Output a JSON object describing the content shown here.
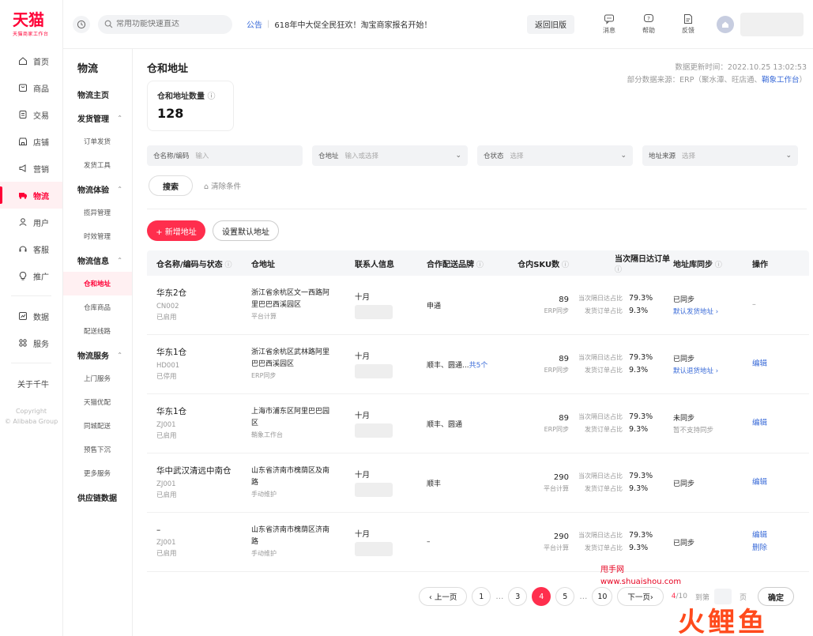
{
  "brand": {
    "name": "天猫",
    "subtitle": "天猫商家工作台"
  },
  "left_nav": {
    "items": [
      {
        "label": "首页",
        "icon": "home-icon"
      },
      {
        "label": "商品",
        "icon": "goods-icon"
      },
      {
        "label": "交易",
        "icon": "trade-icon"
      },
      {
        "label": "店铺",
        "icon": "store-icon"
      },
      {
        "label": "营销",
        "icon": "marketing-icon"
      },
      {
        "label": "物流",
        "icon": "logistics-icon",
        "active": true
      },
      {
        "label": "用户",
        "icon": "user-icon"
      },
      {
        "label": "客服",
        "icon": "service-icon"
      },
      {
        "label": "推广",
        "icon": "promotion-icon"
      }
    ],
    "items2": [
      {
        "label": "数据",
        "icon": "data-icon"
      },
      {
        "label": "服务",
        "icon": "apps-icon"
      }
    ],
    "about": "关于千牛",
    "copyright_1": "Copyright",
    "copyright_2": "© Alibaba Group"
  },
  "topbar": {
    "search_placeholder": "常用功能快速直达",
    "notice_tag": "公告",
    "notice_text": "618年中大促全民狂欢！淘宝商家报名开始！",
    "back_label": "返回旧版",
    "actions": [
      {
        "label": "消息",
        "icon": "message-icon"
      },
      {
        "label": "帮助",
        "icon": "help-icon"
      },
      {
        "label": "反馈",
        "icon": "feedback-icon"
      }
    ]
  },
  "sub_nav": {
    "title": "物流",
    "home": "物流主页",
    "groups": [
      {
        "label": "发货管理",
        "items": [
          "订单发货",
          "发货工具"
        ]
      },
      {
        "label": "物流体验",
        "items": [
          "揽异管理",
          "时效管理"
        ]
      },
      {
        "label": "物流信息",
        "items": [
          "仓和地址",
          "仓库商品",
          "配送线路"
        ]
      },
      {
        "label": "物流服务",
        "items": [
          "上门服务",
          "天猫优配",
          "同城配送",
          "预售下沉",
          "更多服务"
        ]
      }
    ],
    "footer": "供应链数据"
  },
  "main": {
    "title": "仓和地址",
    "update_time": "数据更新时间：2022.10.25 13:02:53",
    "source_prefix": "部分数据来源：ERP（聚水潭、旺店通、",
    "source_link": "鞘象工作台",
    "source_suffix": "）",
    "stat_label": "仓和地址数量",
    "stat_value": "128",
    "filters": [
      {
        "label": "仓名称/编码",
        "placeholder": "输入",
        "has_chevron": false
      },
      {
        "label": "仓地址",
        "placeholder": "输入或选择",
        "has_chevron": true
      },
      {
        "label": "仓状态",
        "placeholder": "选择",
        "has_chevron": true
      },
      {
        "label": "地址来源",
        "placeholder": "选择",
        "has_chevron": true
      }
    ],
    "search_label": "搜索",
    "clear_label": "清除条件",
    "add_label": "+ 新增地址",
    "default_label": "设置默认地址"
  },
  "table": {
    "headers": [
      "仓名称/编码与状态",
      "仓地址",
      "联系人信息",
      "合作配送品牌",
      "仓内SKU数",
      "当次隔日达订单",
      "地址库同步",
      "操作"
    ],
    "ratio_labels": [
      "当次隔日达占比",
      "发货订单占比"
    ],
    "rows": [
      {
        "name": "华东2仓",
        "code": "CN002",
        "state": "已启用",
        "addr1": "浙江省余杭区文一西路阿",
        "addr2": "里巴巴西溪园区",
        "addr_src": "平台计算",
        "contact": "十月",
        "brand": "申通",
        "brand_more": "",
        "sku": "89",
        "sku_src": "ERP同步",
        "r1": "79.3%",
        "r2": "9.3%",
        "sync": "已同步",
        "sync_link": "默认发货地址 ›",
        "sync_note": "",
        "ops": [
          "–"
        ]
      },
      {
        "name": "华东1仓",
        "code": "HD001",
        "state": "已停用",
        "addr1": "浙江省余杭区武林路阿里",
        "addr2": "巴巴西溪园区",
        "addr_src": "ERP同步",
        "contact": "十月",
        "brand": "顺丰、圆通...",
        "brand_more": "共5个",
        "sku": "89",
        "sku_src": "ERP同步",
        "r1": "79.3%",
        "r2": "9.3%",
        "sync": "已同步",
        "sync_link": "默认退货地址 ›",
        "sync_note": "",
        "ops": [
          "编辑"
        ]
      },
      {
        "name": "华东1仓",
        "code": "ZJ001",
        "state": "已启用",
        "addr1": "上海市浦东区阿里巴巴园",
        "addr2": "区",
        "addr_src": "鞘象工作台",
        "contact": "十月",
        "brand": "顺丰、圆通",
        "brand_more": "",
        "sku": "89",
        "sku_src": "ERP同步",
        "r1": "79.3%",
        "r2": "9.3%",
        "sync": "未同步",
        "sync_link": "",
        "sync_note": "暂不支持同步",
        "ops": [
          "编辑"
        ]
      },
      {
        "name": "华中武汉清远中南仓",
        "code": "ZJ001",
        "state": "已启用",
        "addr1": "山东省济南市槐荫区及南",
        "addr2": "路",
        "addr_src": "手动维护",
        "contact": "十月",
        "brand": "顺丰",
        "brand_more": "",
        "sku": "290",
        "sku_src": "平台计算",
        "r1": "79.3%",
        "r2": "9.3%",
        "sync": "已同步",
        "sync_link": "",
        "sync_note": "",
        "ops": [
          "编辑"
        ]
      },
      {
        "name": "–",
        "code": "ZJ001",
        "state": "已启用",
        "addr1": "山东省济南市槐荫区济南",
        "addr2": "路",
        "addr_src": "手动维护",
        "contact": "十月",
        "brand": "–",
        "brand_more": "",
        "sku": "290",
        "sku_src": "平台计算",
        "r1": "79.3%",
        "r2": "9.3%",
        "sync": "已同步",
        "sync_link": "",
        "sync_note": "",
        "ops": [
          "编辑",
          "删除"
        ]
      }
    ]
  },
  "pager": {
    "prev": "‹ 上一页",
    "pages": [
      "1",
      "…",
      "3",
      "4",
      "5",
      "…",
      "10"
    ],
    "active": "4",
    "next": "下一页›",
    "info_cur": "4",
    "info_total": "/10",
    "jump_label": "到第",
    "page_unit": "页",
    "confirm": "确定"
  },
  "watermark": {
    "site_name": "甩手网",
    "site_url": "www.shuaishou.com",
    "logo_text": "火鲤鱼"
  },
  "colors": {
    "brand_red": "#ff0036",
    "button_red": "#ff2e4d",
    "link_blue": "#3a6bd8"
  }
}
